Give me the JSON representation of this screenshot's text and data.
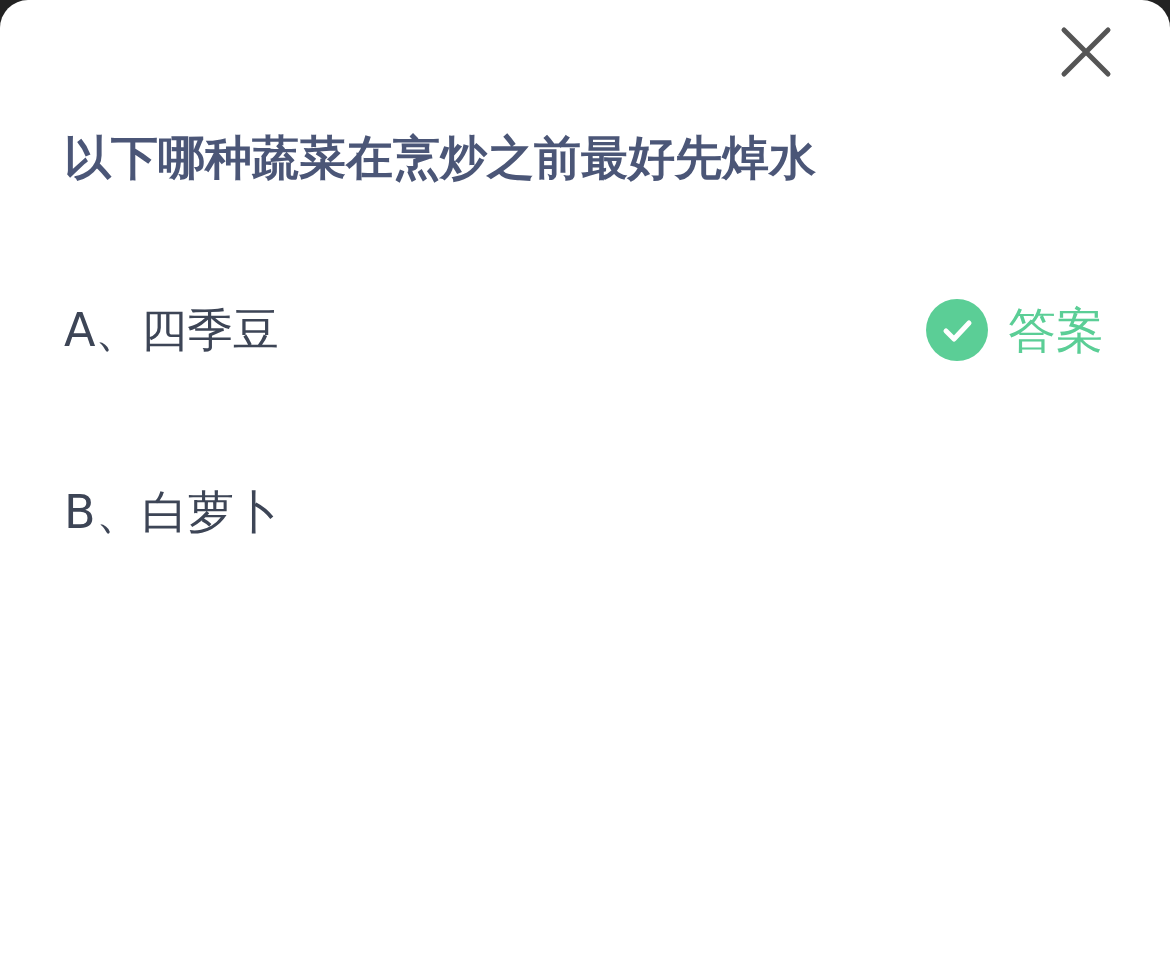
{
  "question": "以下哪种蔬菜在烹炒之前最好先焯水",
  "options": [
    {
      "label": "A、四季豆",
      "correct": true,
      "badge": "答案"
    },
    {
      "label": "B、白萝卜",
      "correct": false
    }
  ]
}
